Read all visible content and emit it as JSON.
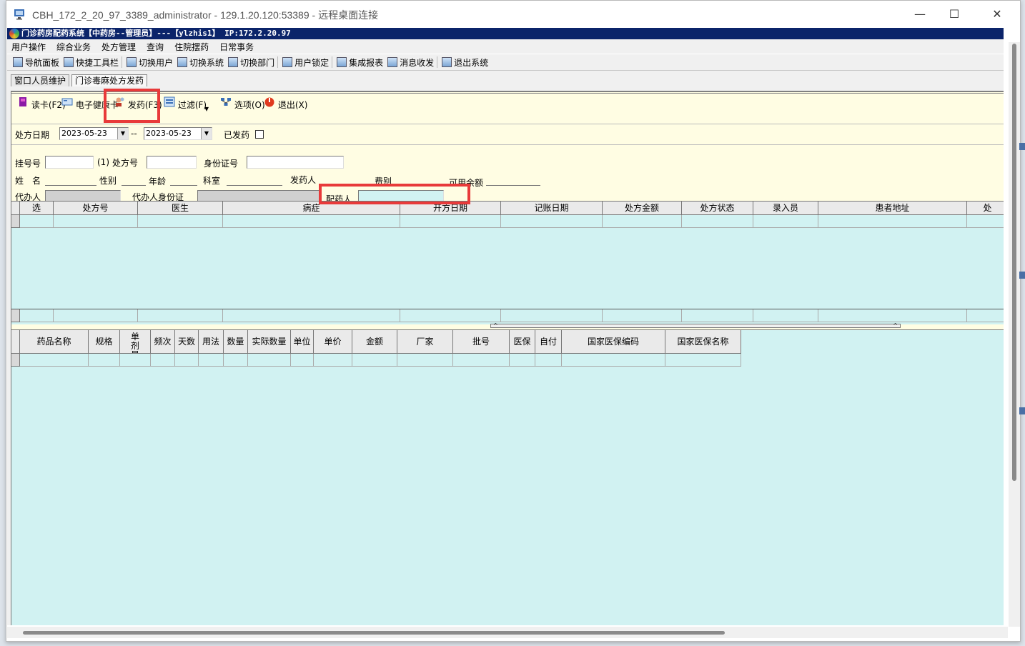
{
  "rdp": {
    "title": "CBH_172_2_20_97_3389_administrator - 129.1.20.120:53389 - 远程桌面连接",
    "minimize": "—",
    "maximize": "☐",
    "close": "✕"
  },
  "app": {
    "title": "门诊药房配药系统【中药房--管理员】---【ylzhis1】 IP:172.2.20.97"
  },
  "menu": [
    "用户操作",
    "综合业务",
    "处方管理",
    "查询",
    "住院摆药",
    "日常事务"
  ],
  "toolbar": [
    {
      "label": "导航面板",
      "icon": "navigation-panel-icon"
    },
    {
      "label": "快捷工具栏",
      "icon": "shortcut-tools-icon"
    },
    {
      "label": "切换用户",
      "icon": "switch-user-icon"
    },
    {
      "label": "切换系统",
      "icon": "switch-system-icon"
    },
    {
      "label": "切换部门",
      "icon": "switch-department-icon"
    },
    {
      "label": "用户锁定",
      "icon": "user-lock-icon"
    },
    {
      "label": "集成报表",
      "icon": "report-icon"
    },
    {
      "label": "消息收发",
      "icon": "message-icon"
    },
    {
      "label": "退出系统",
      "icon": "exit-system-icon"
    }
  ],
  "tabs": [
    "窗口人员维护",
    "门诊毒麻处方发药"
  ],
  "panel_toolbar": {
    "read_card": "读卡(F2)",
    "health_card": "电子健康卡",
    "dispense": "发药(F3)",
    "filter": "过滤(F)",
    "filter_arrow": "▾",
    "options": "选项(O)",
    "exit": "退出(X)"
  },
  "filter": {
    "date_label": "处方日期",
    "date_from": "2023-05-23",
    "date_to": "2023-05-23",
    "separator": "--",
    "dispensed_label": "已发药",
    "dispensed_checked": false
  },
  "patient": {
    "reg_no_label": "挂号号",
    "reg_no_suffix": "(1)",
    "rx_no_label": "处方号",
    "id_label": "身份证号",
    "name_label": "姓　名",
    "sex_label": "性别",
    "age_label": "年龄",
    "dept_label": "科室",
    "dispenser_label": "发药人",
    "fee_label": "费别",
    "balance_label": "可用余额",
    "agent_label": "代办人",
    "agent_id_label": "代办人身份证",
    "preparer_label": "配药人"
  },
  "grid1": {
    "columns": [
      "选",
      "处方号",
      "医生",
      "病症",
      "开方日期",
      "记账日期",
      "处方金额",
      "处方状态",
      "录入员",
      "患者地址",
      "处"
    ]
  },
  "grid2": {
    "columns": [
      "药品名称",
      "规格",
      "单剂量",
      "频次",
      "天数",
      "用法",
      "数量",
      "实际数量",
      "单位",
      "单价",
      "金额",
      "厂家",
      "批号",
      "医保",
      "自付",
      "国家医保编码",
      "国家医保名称"
    ]
  },
  "colors": {
    "title_bar": "#0b246a",
    "panel_bg": "#fffde3",
    "grid_bg": "#d1f2f2",
    "highlight": "#e83a3a"
  }
}
